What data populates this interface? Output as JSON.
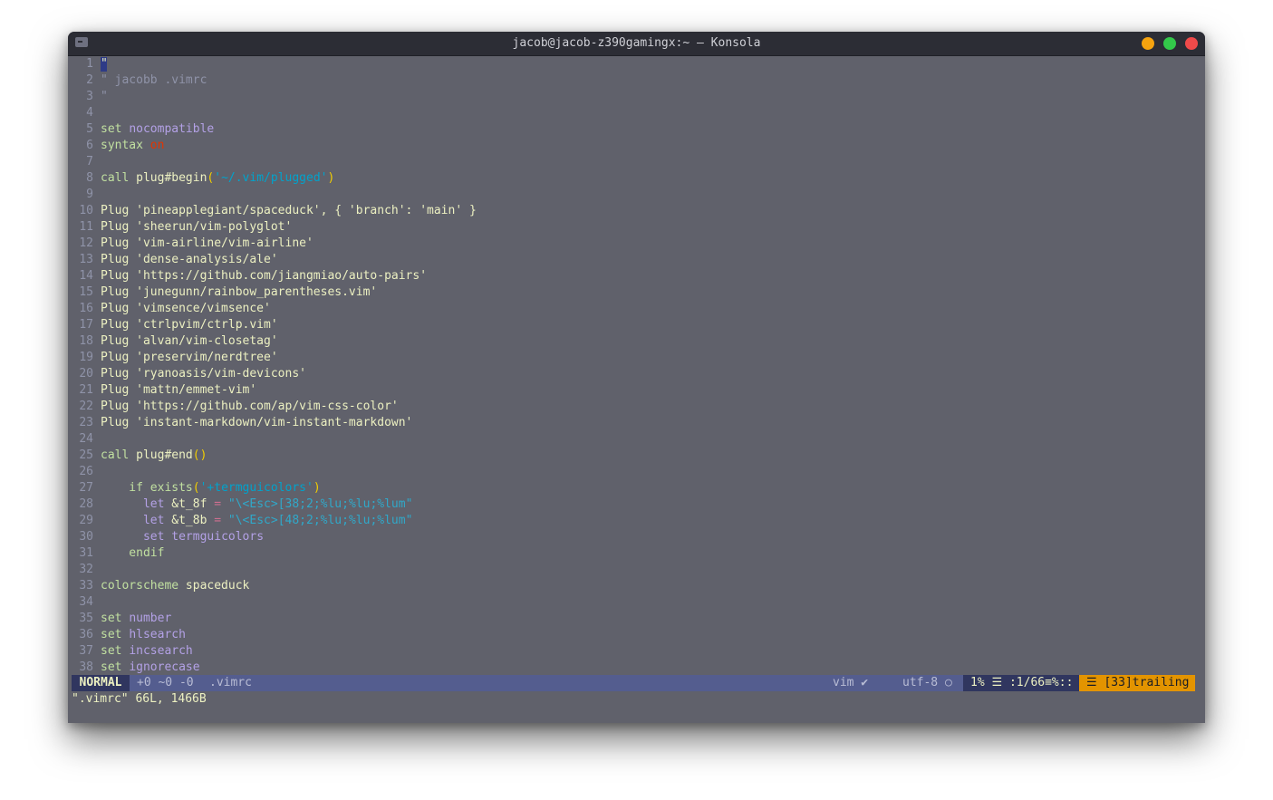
{
  "window": {
    "title": "jacob@jacob-z390gamingx:~ — Konsola"
  },
  "editor": {
    "lines": [
      {
        "n": "1",
        "segs": [
          {
            "t": "\"",
            "c": "cursor"
          }
        ]
      },
      {
        "n": "2",
        "segs": [
          {
            "t": "\" jacobb .vimrc",
            "c": "t-comment"
          }
        ]
      },
      {
        "n": "3",
        "segs": [
          {
            "t": "\"",
            "c": "t-comment"
          }
        ]
      },
      {
        "n": "4",
        "segs": []
      },
      {
        "n": "5",
        "segs": [
          {
            "t": "set ",
            "c": "t-kw"
          },
          {
            "t": "nocompatible",
            "c": "t-opt"
          }
        ]
      },
      {
        "n": "6",
        "segs": [
          {
            "t": "syntax ",
            "c": "t-kw"
          },
          {
            "t": "on",
            "c": "t-on"
          }
        ]
      },
      {
        "n": "7",
        "segs": []
      },
      {
        "n": "8",
        "segs": [
          {
            "t": "call ",
            "c": "t-kw"
          },
          {
            "t": "plug#begin",
            "c": "t-default"
          },
          {
            "t": "(",
            "c": "t-op"
          },
          {
            "t": "'~/.vim/plugged'",
            "c": "t-path"
          },
          {
            "t": ")",
            "c": "t-op"
          }
        ]
      },
      {
        "n": "9",
        "segs": []
      },
      {
        "n": "10",
        "segs": [
          {
            "t": "Plug 'pineapplegiant/spaceduck', { 'branch': 'main' }",
            "c": "t-default"
          }
        ]
      },
      {
        "n": "11",
        "segs": [
          {
            "t": "Plug 'sheerun/vim-polyglot'",
            "c": "t-default"
          }
        ]
      },
      {
        "n": "12",
        "segs": [
          {
            "t": "Plug 'vim-airline/vim-airline'",
            "c": "t-default"
          }
        ]
      },
      {
        "n": "13",
        "segs": [
          {
            "t": "Plug 'dense-analysis/ale'",
            "c": "t-default"
          }
        ]
      },
      {
        "n": "14",
        "segs": [
          {
            "t": "Plug 'https://github.com/jiangmiao/auto-pairs'",
            "c": "t-default"
          }
        ]
      },
      {
        "n": "15",
        "segs": [
          {
            "t": "Plug 'junegunn/rainbow_parentheses.vim'",
            "c": "t-default"
          }
        ]
      },
      {
        "n": "16",
        "segs": [
          {
            "t": "Plug 'vimsence/vimsence'",
            "c": "t-default"
          }
        ]
      },
      {
        "n": "17",
        "segs": [
          {
            "t": "Plug 'ctrlpvim/ctrlp.vim'",
            "c": "t-default"
          }
        ]
      },
      {
        "n": "18",
        "segs": [
          {
            "t": "Plug 'alvan/vim-closetag'",
            "c": "t-default"
          }
        ]
      },
      {
        "n": "19",
        "segs": [
          {
            "t": "Plug 'preservim/nerdtree'",
            "c": "t-default"
          }
        ]
      },
      {
        "n": "20",
        "segs": [
          {
            "t": "Plug 'ryanoasis/vim-devicons'",
            "c": "t-default"
          }
        ]
      },
      {
        "n": "21",
        "segs": [
          {
            "t": "Plug 'mattn/emmet-vim'",
            "c": "t-default"
          }
        ]
      },
      {
        "n": "22",
        "segs": [
          {
            "t": "Plug 'https://github.com/ap/vim-css-color'",
            "c": "t-default"
          }
        ]
      },
      {
        "n": "23",
        "segs": [
          {
            "t": "Plug 'instant-markdown/vim-instant-markdown'",
            "c": "t-default"
          }
        ]
      },
      {
        "n": "24",
        "segs": []
      },
      {
        "n": "25",
        "segs": [
          {
            "t": "call ",
            "c": "t-kw"
          },
          {
            "t": "plug#end",
            "c": "t-default"
          },
          {
            "t": "()",
            "c": "t-op"
          }
        ]
      },
      {
        "n": "26",
        "segs": []
      },
      {
        "n": "27",
        "segs": [
          {
            "t": "    if ",
            "c": "t-kw"
          },
          {
            "t": "exists",
            "c": "t-kw"
          },
          {
            "t": "(",
            "c": "t-op"
          },
          {
            "t": "'+termguicolors'",
            "c": "t-path"
          },
          {
            "t": ")",
            "c": "t-op"
          }
        ]
      },
      {
        "n": "28",
        "segs": [
          {
            "t": "      let ",
            "c": "t-opt"
          },
          {
            "t": "&t_8f",
            "c": "t-default"
          },
          {
            "t": " = ",
            "c": "t-opkw"
          },
          {
            "t": "\"\\<Esc>[38;2;%lu;%lu;%lum\"",
            "c": "t-vimstr"
          }
        ]
      },
      {
        "n": "29",
        "segs": [
          {
            "t": "      let ",
            "c": "t-opt"
          },
          {
            "t": "&t_8b",
            "c": "t-default"
          },
          {
            "t": " = ",
            "c": "t-opkw"
          },
          {
            "t": "\"\\<Esc>[48;2;%lu;%lu;%lum\"",
            "c": "t-vimstr"
          }
        ]
      },
      {
        "n": "30",
        "segs": [
          {
            "t": "      set ",
            "c": "t-opt"
          },
          {
            "t": "termguicolors",
            "c": "t-opt"
          }
        ]
      },
      {
        "n": "31",
        "segs": [
          {
            "t": "    endif",
            "c": "t-kw"
          }
        ]
      },
      {
        "n": "32",
        "segs": []
      },
      {
        "n": "33",
        "segs": [
          {
            "t": "colorscheme ",
            "c": "t-kw"
          },
          {
            "t": "spaceduck",
            "c": "t-default"
          }
        ]
      },
      {
        "n": "34",
        "segs": []
      },
      {
        "n": "35",
        "segs": [
          {
            "t": "set ",
            "c": "t-kw"
          },
          {
            "t": "number",
            "c": "t-opt"
          }
        ]
      },
      {
        "n": "36",
        "segs": [
          {
            "t": "set ",
            "c": "t-kw"
          },
          {
            "t": "hlsearch",
            "c": "t-opt"
          }
        ]
      },
      {
        "n": "37",
        "segs": [
          {
            "t": "set ",
            "c": "t-kw"
          },
          {
            "t": "incsearch",
            "c": "t-opt"
          }
        ]
      },
      {
        "n": "38",
        "segs": [
          {
            "t": "set ",
            "c": "t-kw"
          },
          {
            "t": "ignorecase",
            "c": "t-opt"
          }
        ]
      }
    ]
  },
  "statusline": {
    "mode": "NORMAL",
    "branch": "+0 ~0 -0",
    "filename": ".vimrc",
    "filetype": "vim ✔",
    "encoding": "utf-8 ○",
    "position": "1% ☰ :1/66≡%::",
    "warning": "☰ [33]trailing"
  },
  "cmdline": "\".vimrc\" 66L, 1466B"
}
